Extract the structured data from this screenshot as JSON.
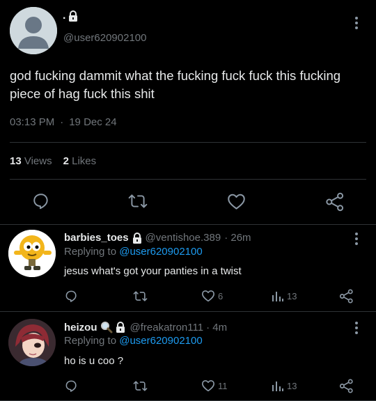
{
  "tweet": {
    "display_name": ".",
    "handle": "@user620902100",
    "text_line1": "god fucking dammit what the fucking fuck fuck this fucking",
    "text_line2": "piece of hag fuck this shit",
    "time": "03:13 PM",
    "separator": "·",
    "date": "19 Dec 24",
    "views_count": "13",
    "views_label": "Views",
    "likes_count": "2",
    "likes_label": "Likes"
  },
  "replies": [
    {
      "name": "barbies_toes",
      "handle": "@ventishoe.389",
      "time": "· 26m",
      "replying_prefix": "Replying to",
      "replying_to": "@user620902100",
      "text": "jesus what's got your panties in a twist",
      "likes": "6",
      "views": "13"
    },
    {
      "name": "heizou",
      "handle": "@freakatron111",
      "time": "· 4m",
      "replying_prefix": "Replying to",
      "replying_to": "@user620902100",
      "text": "ho is u coo ?",
      "likes": "11",
      "views": "13"
    }
  ],
  "colors": {
    "background": "#000000",
    "text": "#e7e9ea",
    "muted": "#71767b",
    "link": "#1d9bf0",
    "divider": "#2f3336"
  }
}
